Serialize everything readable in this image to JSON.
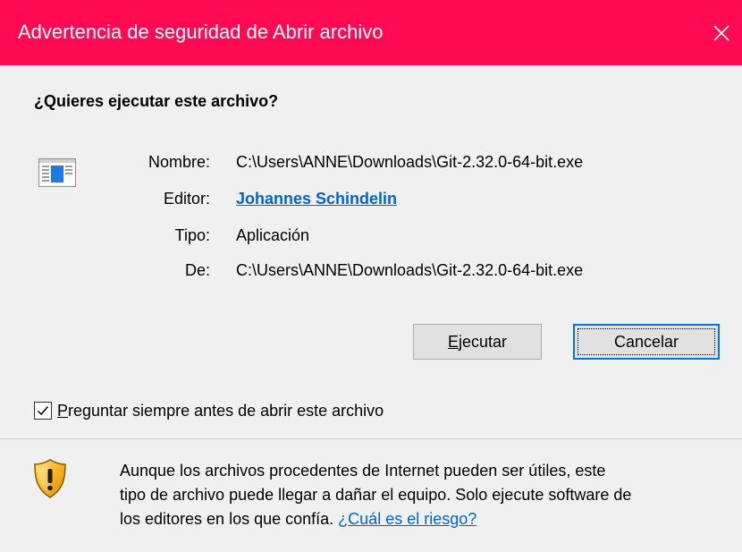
{
  "window": {
    "title": "Advertencia de seguridad de Abrir archivo",
    "titlebar_color": "#ff0a53"
  },
  "question": "¿Quieres ejecutar este archivo?",
  "file_icon": "application-window-icon",
  "fields": {
    "name": {
      "label": "Nombre:",
      "value": "C:\\Users\\ANNE\\Downloads\\Git-2.32.0-64-bit.exe"
    },
    "publisher": {
      "label": "Editor:",
      "value": "Johannes Schindelin"
    },
    "type": {
      "label": "Tipo:",
      "value": "Aplicación"
    },
    "from": {
      "label": "De:",
      "value": "C:\\Users\\ANNE\\Downloads\\Git-2.32.0-64-bit.exe"
    }
  },
  "buttons": {
    "run": {
      "access_key": "E",
      "rest": "jecutar"
    },
    "cancel": {
      "label": "Cancelar"
    }
  },
  "checkbox": {
    "checked": true,
    "access_key": "P",
    "rest": "reguntar siempre antes de abrir este archivo"
  },
  "warning": {
    "icon": "shield-warning-icon",
    "line1": "Aunque los archivos procedentes de Internet pueden ser útiles, este",
    "line2": "tipo de archivo puede llegar a dañar el equipo. Solo ejecute software de",
    "line3_prefix": "los editores en los que confía.",
    "link": "¿Cuál es el riesgo?"
  },
  "colors": {
    "link": "#0066cc",
    "accent": "#0078d7",
    "background": "#f0f0f0"
  }
}
